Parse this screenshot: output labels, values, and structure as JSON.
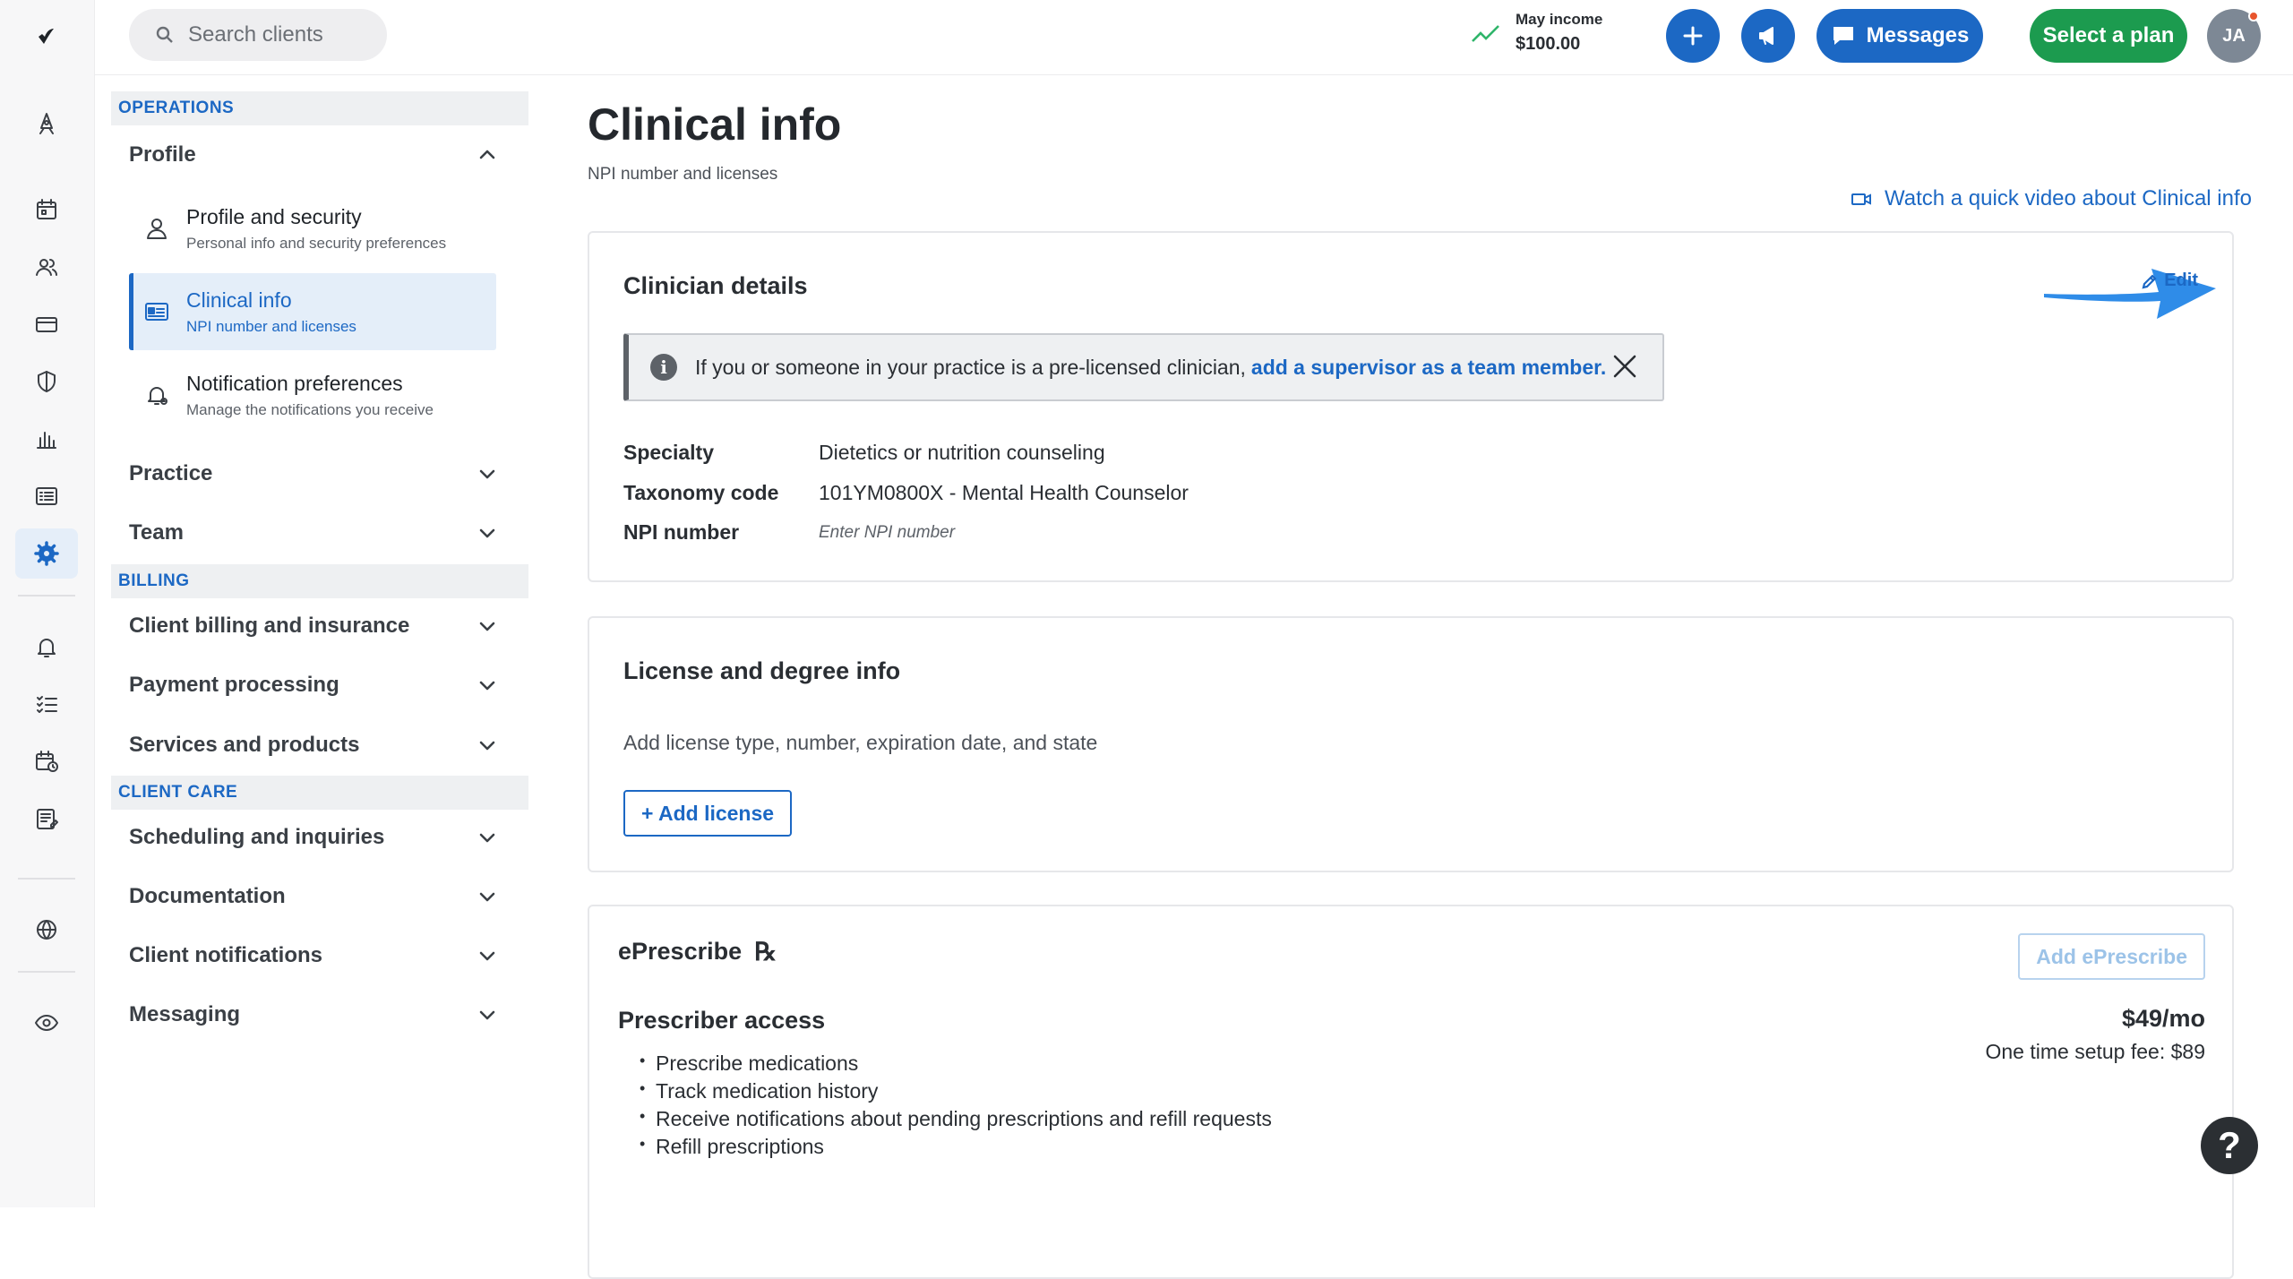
{
  "topbar": {
    "search_placeholder": "Search clients",
    "income_label": "May income",
    "income_value": "$100.00",
    "messages_label": "Messages",
    "select_plan_label": "Select a plan",
    "avatar_initials": "JA"
  },
  "rail": {
    "icons": [
      "logo-icon",
      "rocket-icon",
      "calendar-icon",
      "clients-icon",
      "billing-card-icon",
      "shield-icon",
      "analytics-icon",
      "list-icon",
      "settings-gear-icon",
      "bell-icon",
      "tasks-icon",
      "calendar-clock-icon",
      "notes-icon",
      "globe-icon",
      "eye-icon"
    ],
    "active": "settings-gear-icon"
  },
  "nav": {
    "operations_header": "OPERATIONS",
    "profile_group": "Profile",
    "profile_items": [
      {
        "title": "Profile and security",
        "desc": "Personal info and security preferences"
      },
      {
        "title": "Clinical info",
        "desc": "NPI number and licenses"
      },
      {
        "title": "Notification preferences",
        "desc": "Manage the notifications you receive"
      }
    ],
    "practice_group": "Practice",
    "team_group": "Team",
    "billing_header": "BILLING",
    "billing_groups": [
      "Client billing and insurance",
      "Payment processing",
      "Services and products"
    ],
    "client_care_header": "CLIENT CARE",
    "client_care_groups": [
      "Scheduling and inquiries",
      "Documentation",
      "Client notifications",
      "Messaging"
    ]
  },
  "main": {
    "title": "Clinical info",
    "subtitle": "NPI number and licenses",
    "video_link": "Watch a quick video about Clinical info",
    "clinician": {
      "title": "Clinician details",
      "edit_label": "Edit",
      "alert_text": "If you or someone in your practice is a pre-licensed clinician,",
      "alert_link": "add a supervisor as a team member.",
      "rows": [
        {
          "key": "Specialty",
          "value": "Dietetics or nutrition counseling"
        },
        {
          "key": "Taxonomy code",
          "value": "101YM0800X - Mental Health Counselor"
        },
        {
          "key": "NPI number",
          "value": "Enter NPI number"
        }
      ]
    },
    "license": {
      "title": "License and degree info",
      "desc": "Add license type, number, expiration date, and state",
      "add_label": "+ Add license"
    },
    "eprescribe": {
      "title": "ePrescribe",
      "rx_symbol": "℞",
      "add_label": "Add ePrescribe",
      "access_title": "Prescriber access",
      "price": "$49/mo",
      "setup_fee": "One time setup fee: $89",
      "features": [
        "Prescribe medications",
        "Track medication history",
        "Receive notifications about pending prescriptions and refill requests",
        "Refill prescriptions"
      ]
    }
  },
  "help_label": "?",
  "colors": {
    "accent": "#1c68c4",
    "green": "#1c9b4f",
    "arrow": "#2f8ce8"
  }
}
